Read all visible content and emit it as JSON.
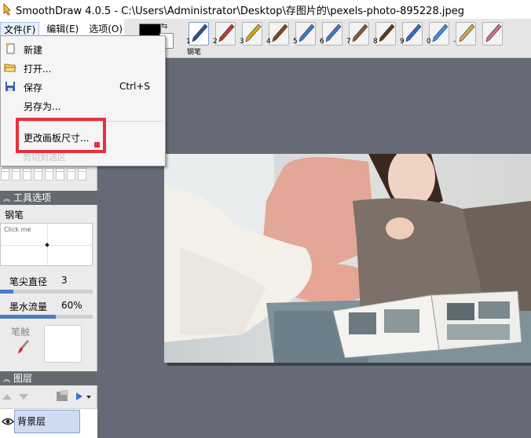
{
  "window": {
    "title": "SmoothDraw 4.0.5 - C:\\Users\\Administrator\\Desktop\\存图片的\\pexels-photo-895228.jpeg"
  },
  "menubar": {
    "file": "文件(F)",
    "edit": "编辑(E)",
    "options": "选项(O)"
  },
  "file_menu": {
    "items": [
      {
        "label": "新建",
        "shortcut": "",
        "icon": "new-file-icon"
      },
      {
        "label": "打开...",
        "shortcut": "",
        "icon": "open-folder-icon"
      },
      {
        "label": "保存",
        "shortcut": "Ctrl+S",
        "icon": "save-disk-icon"
      },
      {
        "label": "另存为...",
        "shortcut": "",
        "icon": ""
      }
    ],
    "resize_canvas": "更改画板尺寸...",
    "behind_text": "剪切到选区"
  },
  "toolbar": {
    "tools": [
      {
        "num": "1",
        "icon": "pen-icon"
      },
      {
        "num": "2",
        "icon": "pencil-icon"
      },
      {
        "num": "3",
        "icon": "highlighter-icon"
      },
      {
        "num": "4",
        "icon": "brush-icon"
      },
      {
        "num": "5",
        "icon": "airbrush-icon"
      },
      {
        "num": "6",
        "icon": "spray-icon"
      },
      {
        "num": "7",
        "icon": "bristle-brush-icon"
      },
      {
        "num": "8",
        "icon": "flat-brush-icon"
      },
      {
        "num": "9",
        "icon": "star-stamp-icon"
      },
      {
        "num": "0",
        "icon": "water-drop-icon"
      },
      {
        "num": "-",
        "icon": "smudge-hand-icon"
      },
      {
        "num": "",
        "icon": "eraser-icon"
      }
    ],
    "selected_caption": "钢笔"
  },
  "tool_options": {
    "header": "工具选项",
    "tool_name": "钢笔",
    "click_me": "Click me",
    "tip_diameter_label": "笔尖直径",
    "tip_diameter_value": "3",
    "ink_flow_label": "墨水流量",
    "ink_flow_value": "60%",
    "ink_flow_fraction": 0.6,
    "tip_diameter_fraction": 0.14,
    "brush_label": "笔触"
  },
  "layers": {
    "header": "图层",
    "layer_name": "背景层"
  },
  "colors": {
    "canvas_bg": "#656a76",
    "panel_header": "#666a70",
    "highlight": "#e8313c",
    "accent": "#4f79c6"
  }
}
